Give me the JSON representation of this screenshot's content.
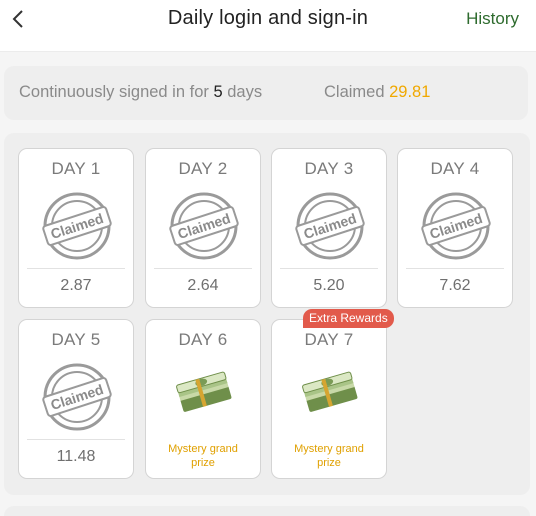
{
  "header": {
    "title": "Daily login and sign-in",
    "history_label": "History"
  },
  "summary": {
    "prefix": "Continuously signed in for",
    "days": "5",
    "suffix": "days",
    "claimed_label": "Claimed",
    "claimed_amount": "29.81"
  },
  "stamp_text": "Claimed",
  "days": [
    {
      "label": "DAY 1",
      "amount": "2.87"
    },
    {
      "label": "DAY 2",
      "amount": "2.64"
    },
    {
      "label": "DAY 3",
      "amount": "5.20"
    },
    {
      "label": "DAY 4",
      "amount": "7.62"
    },
    {
      "label": "DAY 5",
      "amount": "11.48"
    },
    {
      "label": "DAY 6",
      "prize_line1": "Mystery grand",
      "prize_line2": "prize"
    },
    {
      "label": "DAY 7",
      "prize_line1": "Mystery grand",
      "prize_line2": "prize",
      "badge": "Extra Rewards"
    }
  ],
  "colors": {
    "accent": "#f0a800",
    "history": "#2e6b2e",
    "badge": "#e25a4b"
  },
  "icons": {
    "back": "chevron-left-icon",
    "stamp": "claimed-stamp-icon",
    "prize": "money-stack-icon"
  }
}
